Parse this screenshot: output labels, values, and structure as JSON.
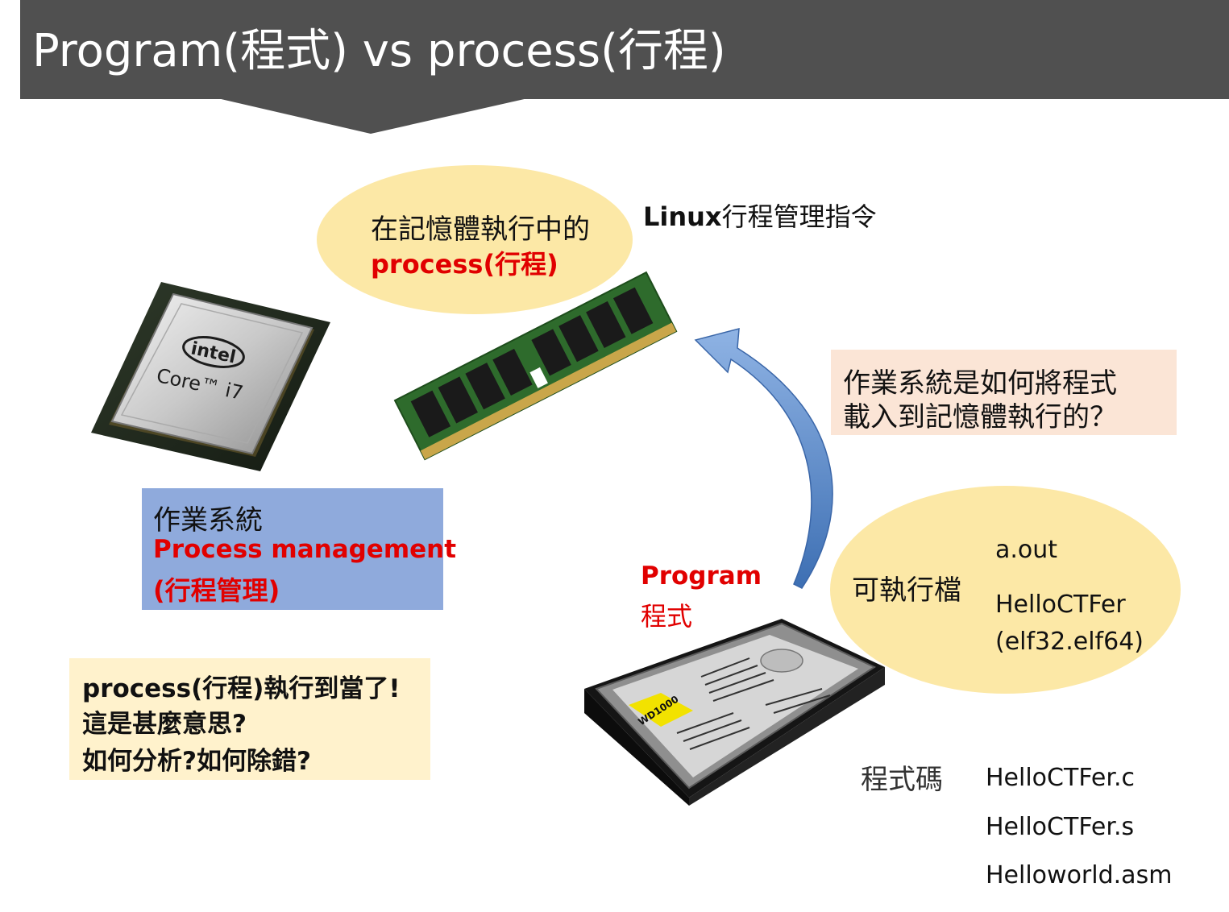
{
  "header": {
    "title": "Program(程式) vs process(行程)"
  },
  "memory": {
    "line1": "在記憶體執行中的",
    "line2": "process(行程)"
  },
  "linux_cmd": {
    "bold": "Linux",
    "rest": "行程管理指令"
  },
  "os": {
    "line1": "作業系統",
    "line2": "Process management",
    "line3": "(行程管理)"
  },
  "question": {
    "line1": "作業系統是如何將程式",
    "line2": "載入到記憶體執行的？"
  },
  "crash": {
    "line1": "process(行程)執行到當了!",
    "line2": "這是甚麼意思?",
    "line3": "如何分析?如何除錯?"
  },
  "program": {
    "line1": "Program",
    "line2": "程式"
  },
  "executable": {
    "label": "可執行檔",
    "files": [
      "a.out",
      "HelloCTFer",
      "(elf32.elf64)"
    ]
  },
  "source": {
    "label": "程式碼",
    "files": [
      "HelloCTFer.c",
      "HelloCTFer.s",
      "Helloworld.asm"
    ]
  },
  "cpu": {
    "brand": "intel",
    "model": "Core™ i7"
  },
  "hdd": {
    "model": "WD1000"
  },
  "colors": {
    "header": "#505050",
    "bubble": "#fce8a6",
    "os_box": "#8faadc",
    "question_box": "#fbe5d6",
    "crash_box": "#fff2cc",
    "accent_red": "#e10000",
    "arrow_blue": "#4a7fc1"
  }
}
